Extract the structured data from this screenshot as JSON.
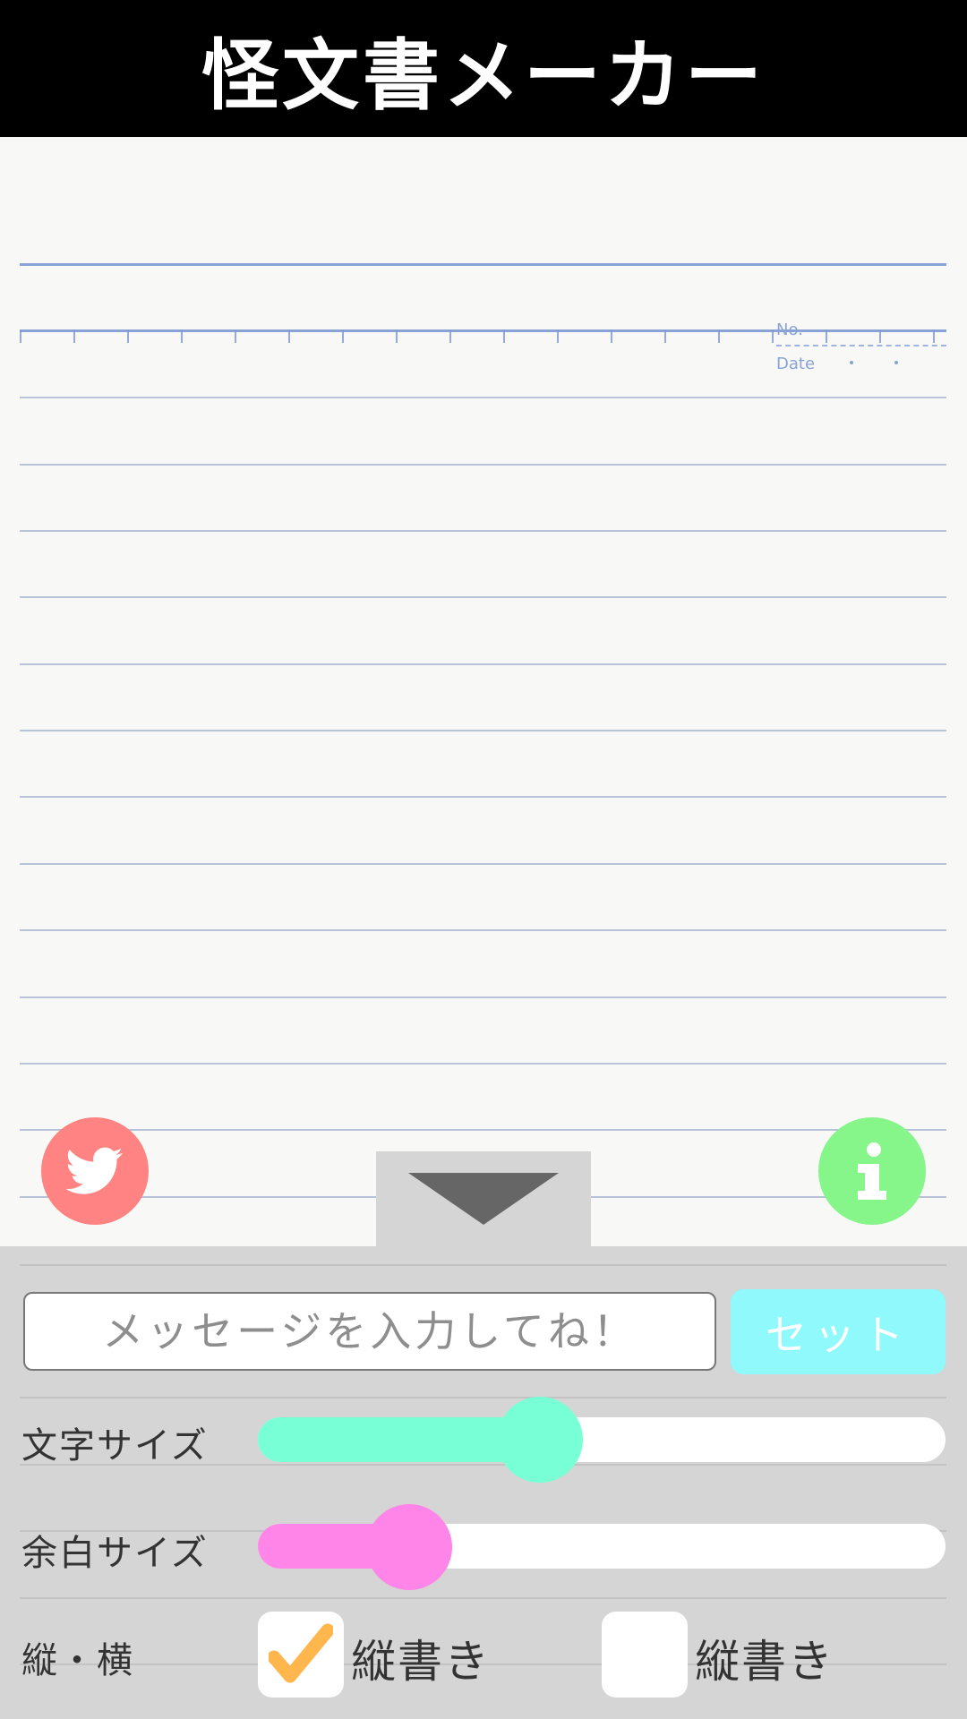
{
  "header": {
    "title": "怪文書メーカー"
  },
  "paper": {
    "no_label": "No.",
    "date_label": "Date"
  },
  "buttons": {
    "twitter_icon": "twitter-bird-icon",
    "info_icon": "info-icon",
    "toggle_icon": "triangle-down-icon"
  },
  "message": {
    "placeholder": "メッセージを入力してね！",
    "value": "",
    "set_label": "セット"
  },
  "font_size": {
    "label": "文字サイズ",
    "level": 0.41,
    "color": "#78ffd6"
  },
  "margin_size": {
    "label": "余白サイズ",
    "level": 0.22,
    "color": "#ff85e8"
  },
  "orientation": {
    "label": "縦・横",
    "option1": {
      "label": "縦書き",
      "checked": true
    },
    "option2": {
      "label": "縦書き",
      "checked": false
    },
    "check_color": "#ffb64c"
  },
  "colors": {
    "twitter": "#ff8383",
    "info": "#86f58a",
    "set_button": "#8ff9fb"
  }
}
